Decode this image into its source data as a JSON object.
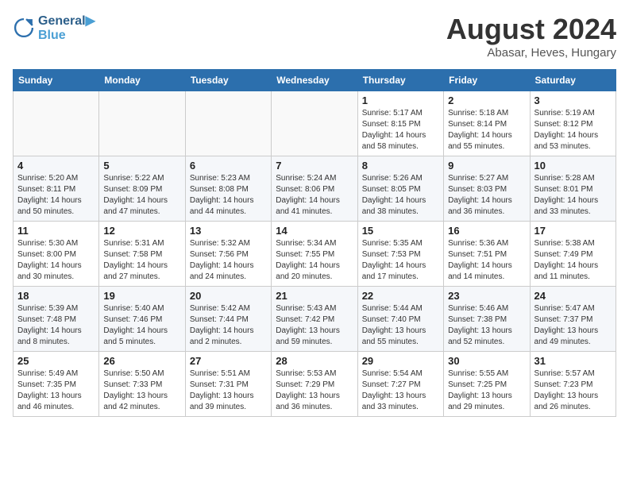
{
  "header": {
    "logo_line1": "General",
    "logo_line2": "Blue",
    "month_year": "August 2024",
    "location": "Abasar, Heves, Hungary"
  },
  "weekdays": [
    "Sunday",
    "Monday",
    "Tuesday",
    "Wednesday",
    "Thursday",
    "Friday",
    "Saturday"
  ],
  "weeks": [
    [
      {
        "day": "",
        "info": ""
      },
      {
        "day": "",
        "info": ""
      },
      {
        "day": "",
        "info": ""
      },
      {
        "day": "",
        "info": ""
      },
      {
        "day": "1",
        "info": "Sunrise: 5:17 AM\nSunset: 8:15 PM\nDaylight: 14 hours\nand 58 minutes."
      },
      {
        "day": "2",
        "info": "Sunrise: 5:18 AM\nSunset: 8:14 PM\nDaylight: 14 hours\nand 55 minutes."
      },
      {
        "day": "3",
        "info": "Sunrise: 5:19 AM\nSunset: 8:12 PM\nDaylight: 14 hours\nand 53 minutes."
      }
    ],
    [
      {
        "day": "4",
        "info": "Sunrise: 5:20 AM\nSunset: 8:11 PM\nDaylight: 14 hours\nand 50 minutes."
      },
      {
        "day": "5",
        "info": "Sunrise: 5:22 AM\nSunset: 8:09 PM\nDaylight: 14 hours\nand 47 minutes."
      },
      {
        "day": "6",
        "info": "Sunrise: 5:23 AM\nSunset: 8:08 PM\nDaylight: 14 hours\nand 44 minutes."
      },
      {
        "day": "7",
        "info": "Sunrise: 5:24 AM\nSunset: 8:06 PM\nDaylight: 14 hours\nand 41 minutes."
      },
      {
        "day": "8",
        "info": "Sunrise: 5:26 AM\nSunset: 8:05 PM\nDaylight: 14 hours\nand 38 minutes."
      },
      {
        "day": "9",
        "info": "Sunrise: 5:27 AM\nSunset: 8:03 PM\nDaylight: 14 hours\nand 36 minutes."
      },
      {
        "day": "10",
        "info": "Sunrise: 5:28 AM\nSunset: 8:01 PM\nDaylight: 14 hours\nand 33 minutes."
      }
    ],
    [
      {
        "day": "11",
        "info": "Sunrise: 5:30 AM\nSunset: 8:00 PM\nDaylight: 14 hours\nand 30 minutes."
      },
      {
        "day": "12",
        "info": "Sunrise: 5:31 AM\nSunset: 7:58 PM\nDaylight: 14 hours\nand 27 minutes."
      },
      {
        "day": "13",
        "info": "Sunrise: 5:32 AM\nSunset: 7:56 PM\nDaylight: 14 hours\nand 24 minutes."
      },
      {
        "day": "14",
        "info": "Sunrise: 5:34 AM\nSunset: 7:55 PM\nDaylight: 14 hours\nand 20 minutes."
      },
      {
        "day": "15",
        "info": "Sunrise: 5:35 AM\nSunset: 7:53 PM\nDaylight: 14 hours\nand 17 minutes."
      },
      {
        "day": "16",
        "info": "Sunrise: 5:36 AM\nSunset: 7:51 PM\nDaylight: 14 hours\nand 14 minutes."
      },
      {
        "day": "17",
        "info": "Sunrise: 5:38 AM\nSunset: 7:49 PM\nDaylight: 14 hours\nand 11 minutes."
      }
    ],
    [
      {
        "day": "18",
        "info": "Sunrise: 5:39 AM\nSunset: 7:48 PM\nDaylight: 14 hours\nand 8 minutes."
      },
      {
        "day": "19",
        "info": "Sunrise: 5:40 AM\nSunset: 7:46 PM\nDaylight: 14 hours\nand 5 minutes."
      },
      {
        "day": "20",
        "info": "Sunrise: 5:42 AM\nSunset: 7:44 PM\nDaylight: 14 hours\nand 2 minutes."
      },
      {
        "day": "21",
        "info": "Sunrise: 5:43 AM\nSunset: 7:42 PM\nDaylight: 13 hours\nand 59 minutes."
      },
      {
        "day": "22",
        "info": "Sunrise: 5:44 AM\nSunset: 7:40 PM\nDaylight: 13 hours\nand 55 minutes."
      },
      {
        "day": "23",
        "info": "Sunrise: 5:46 AM\nSunset: 7:38 PM\nDaylight: 13 hours\nand 52 minutes."
      },
      {
        "day": "24",
        "info": "Sunrise: 5:47 AM\nSunset: 7:37 PM\nDaylight: 13 hours\nand 49 minutes."
      }
    ],
    [
      {
        "day": "25",
        "info": "Sunrise: 5:49 AM\nSunset: 7:35 PM\nDaylight: 13 hours\nand 46 minutes."
      },
      {
        "day": "26",
        "info": "Sunrise: 5:50 AM\nSunset: 7:33 PM\nDaylight: 13 hours\nand 42 minutes."
      },
      {
        "day": "27",
        "info": "Sunrise: 5:51 AM\nSunset: 7:31 PM\nDaylight: 13 hours\nand 39 minutes."
      },
      {
        "day": "28",
        "info": "Sunrise: 5:53 AM\nSunset: 7:29 PM\nDaylight: 13 hours\nand 36 minutes."
      },
      {
        "day": "29",
        "info": "Sunrise: 5:54 AM\nSunset: 7:27 PM\nDaylight: 13 hours\nand 33 minutes."
      },
      {
        "day": "30",
        "info": "Sunrise: 5:55 AM\nSunset: 7:25 PM\nDaylight: 13 hours\nand 29 minutes."
      },
      {
        "day": "31",
        "info": "Sunrise: 5:57 AM\nSunset: 7:23 PM\nDaylight: 13 hours\nand 26 minutes."
      }
    ]
  ]
}
